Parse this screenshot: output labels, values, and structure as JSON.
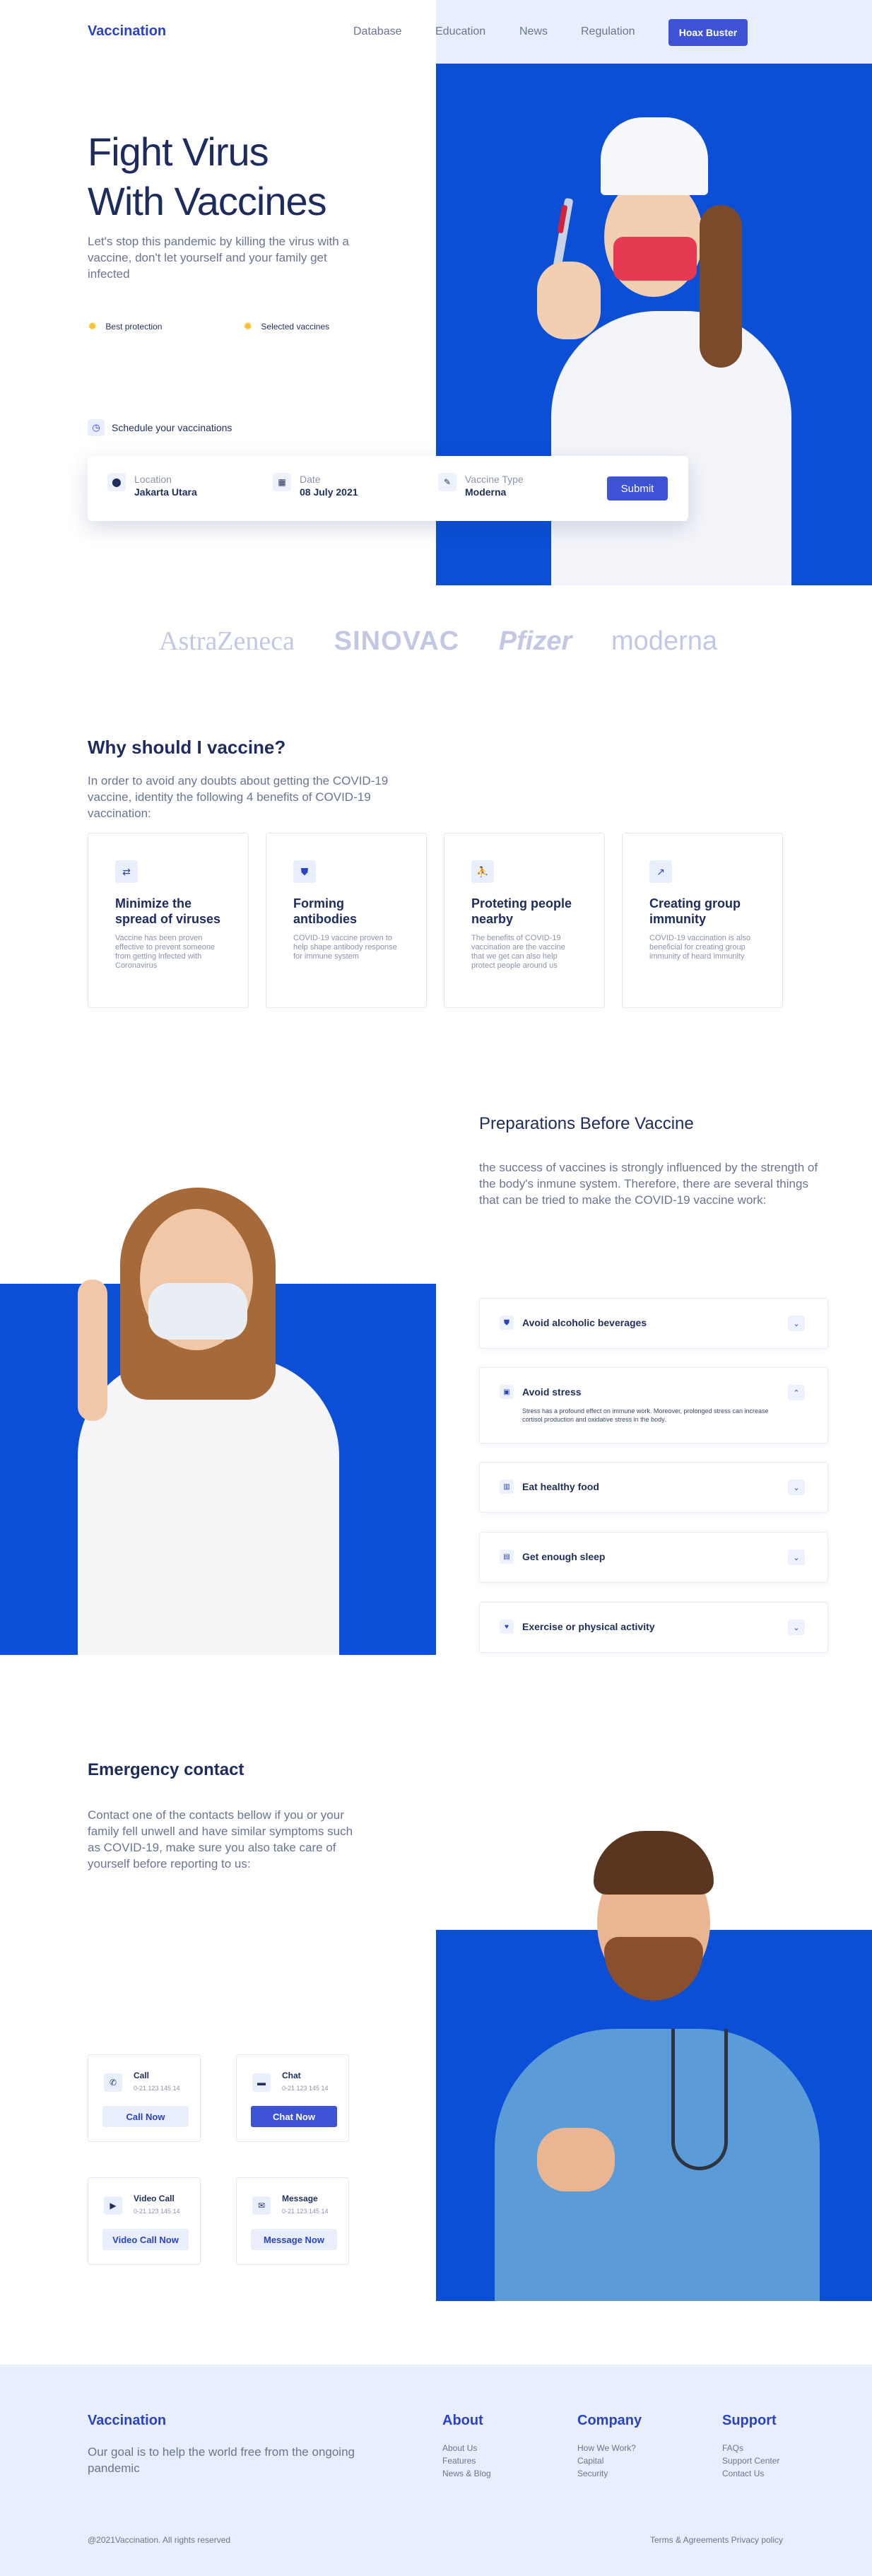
{
  "nav": {
    "brand": "Vaccination",
    "links": [
      "Database",
      "Education",
      "News",
      "Regulation"
    ],
    "cta": "Hoax Buster"
  },
  "hero": {
    "title_line1": "Fight Virus",
    "title_line2": "With Vaccines",
    "subtitle": "Let's stop this pandemic by killing the virus with a vaccine, don't let yourself and your family get infected",
    "features": [
      "Best protection",
      "Selected vaccines"
    ],
    "schedule_label": "Schedule your vaccinations",
    "form": {
      "location_label": "Location",
      "location_value": "Jakarta Utara",
      "date_label": "Date",
      "date_value": "08 July 2021",
      "type_label": "Vaccine Type",
      "type_value": "Moderna",
      "submit": "Submit"
    }
  },
  "partners": [
    "AstraZeneca",
    "SINOVAC",
    "Pfizer",
    "moderna"
  ],
  "why": {
    "title": "Why should I vaccine?",
    "subtitle": "In order to avoid any doubts about getting the COVID-19 vaccine, identity the following 4 benefits of COVID-19 vaccination:",
    "cards": [
      {
        "title": "Minimize the spread of viruses",
        "desc": "Vaccine has been proven effective to prevent someone from getting infected with Coronavirus",
        "icon": "arrows-icon"
      },
      {
        "title": "Forming antibodies",
        "desc": "COVID-19 vaccine proven to help shape antibody response for immune system",
        "icon": "shield-icon"
      },
      {
        "title": "Proteting people nearby",
        "desc": "The benefits of COVID-19 vaccination are the vaccine that we get can also help protect people around us",
        "icon": "people-icon"
      },
      {
        "title": "Creating group immunity",
        "desc": "COVID-19 vaccination is also beneficial for creating group immunity of heard immunity",
        "icon": "trend-icon"
      }
    ]
  },
  "prep": {
    "title": "Preparations Before Vaccine",
    "subtitle": "the success of vaccines is strongly influenced by the strength of the body's inmune system. Therefore, there are several things that can be tried to make the COVID-19 vaccine work:",
    "items": [
      {
        "label": "Avoid alcoholic beverages",
        "icon": "shield-icon",
        "open": false
      },
      {
        "label": "Avoid stress",
        "icon": "stress-icon",
        "open": true,
        "body": "Stress has a profound effect on immune work. Moreover, prolonged stress can increase cortisol production and oxidative stress in the body."
      },
      {
        "label": "Eat healthy food",
        "icon": "food-icon",
        "open": false
      },
      {
        "label": "Get enough sleep",
        "icon": "sleep-icon",
        "open": false
      },
      {
        "label": "Exercise or physical activity",
        "icon": "heart-icon",
        "open": false
      }
    ]
  },
  "emergency": {
    "title": "Emergency contact",
    "subtitle": "Contact one of the contacts bellow if you or your family fell unwell and have similar symptoms such as COVID-19, make sure you also take care of yourself before reporting to us:",
    "contacts": [
      {
        "title": "Call",
        "phone": "0-21 123 145 14",
        "button": "Call Now"
      },
      {
        "title": "Chat",
        "phone": "0-21 123 145 14",
        "button": "Chat Now"
      },
      {
        "title": "Video Call",
        "phone": "0-21 123 145 14",
        "button": "Video Call Now"
      },
      {
        "title": "Message",
        "phone": "0-21 123 145 14",
        "button": "Message Now"
      }
    ]
  },
  "footer": {
    "brand": "Vaccination",
    "desc": "Our goal is to help the world free from the ongoing pandemic",
    "columns": [
      {
        "title": "About",
        "links": [
          "About Us",
          "Features",
          "News & Blog"
        ]
      },
      {
        "title": "Company",
        "links": [
          "How We Work?",
          "Capital",
          "Security"
        ]
      },
      {
        "title": "Support",
        "links": [
          "FAQs",
          "Support Center",
          "Contact Us"
        ]
      }
    ],
    "copyright": "@2021Vaccination. All rights reserved",
    "terms": "Terms & Agreements Privacy policy"
  }
}
